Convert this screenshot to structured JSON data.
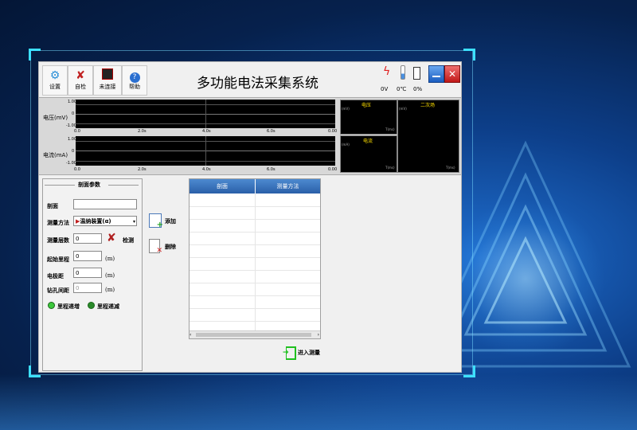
{
  "colors": {
    "accent": "#3de0ff",
    "plot_bg": "#000000",
    "plot_label": "#ffe000",
    "header": "#2a5fa8",
    "close": "#e02020"
  },
  "toolbar": {
    "buttons": [
      {
        "label": "设置",
        "icon": "gear-icon"
      },
      {
        "label": "自检",
        "icon": "tools-icon"
      },
      {
        "label": "未连接",
        "icon": "device-icon"
      },
      {
        "label": "帮助",
        "icon": "help-icon"
      }
    ]
  },
  "app": {
    "title": "多功能电法采集系统"
  },
  "status": {
    "voltage": "0V",
    "temperature": "0℃",
    "battery": "0%"
  },
  "charts": {
    "voltage": {
      "label": "电压(mV)",
      "yticks": [
        "1.00",
        "0",
        "-1.00"
      ],
      "xticks": [
        "0.0",
        "2.0s",
        "4.0s",
        "6.0s",
        "0.00"
      ]
    },
    "current": {
      "label": "电流(mA)",
      "yticks": [
        "1.00",
        "0",
        "-1.00"
      ],
      "xticks": [
        "0.0",
        "2.0s",
        "4.0s",
        "6.0s",
        "0.00"
      ]
    },
    "mini": {
      "voltage": "电压",
      "secondary_field": "二次场",
      "current": "电流",
      "axis_v": "(mV)",
      "axis_t": "T(ms)",
      "axis_a": "(mA)"
    }
  },
  "params": {
    "section_title": "剖面参数",
    "profile_label": "剖面",
    "profile_value": "",
    "method_label": "测量方法",
    "method_value": "温纳装置(α)",
    "layers_label": "测量层数",
    "layers_value": "0",
    "check_label": "检测",
    "start_label": "起始里程",
    "start_value": "0",
    "start_unit": "(m)",
    "spacing_label": "电极距",
    "spacing_value": "0",
    "spacing_unit": "(m)",
    "hole_label": "钻孔间距",
    "hole_value": "0",
    "hole_unit": "(m)",
    "radio_inc": "里程递增",
    "radio_dec": "里程递减"
  },
  "actions": {
    "add": "添加",
    "delete": "删除",
    "enter": "进入测量"
  },
  "table": {
    "columns": [
      "剖面",
      "测量方法"
    ]
  }
}
